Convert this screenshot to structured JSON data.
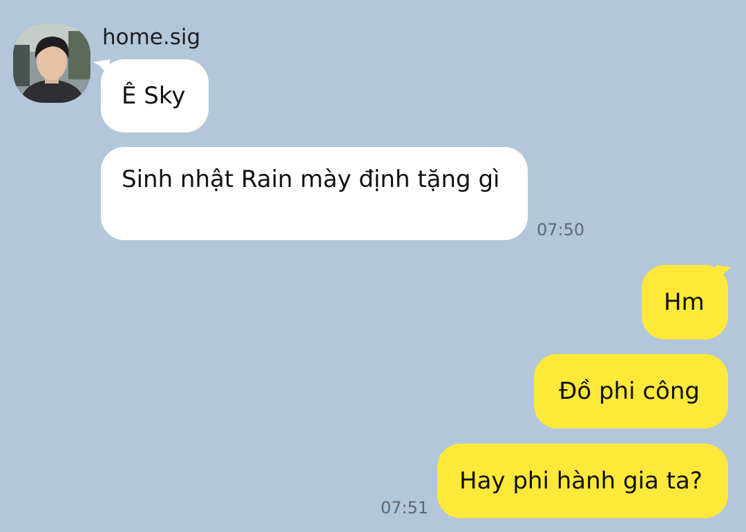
{
  "conversation": {
    "contact": {
      "name": "home.sig",
      "avatar_icon": "profile-photo"
    },
    "incoming": [
      {
        "text": "Ê Sky"
      },
      {
        "text": "Sinh nhật Rain mày định tặng gì"
      }
    ],
    "incoming_time": "07:50",
    "outgoing": [
      {
        "text": "Hm"
      },
      {
        "text": "Đồ phi công"
      },
      {
        "text": "Hay phi hành gia ta?"
      }
    ],
    "outgoing_time": "07:51"
  },
  "colors": {
    "background": "#b2c7da",
    "incoming_bubble": "#ffffff",
    "outgoing_bubble": "#fee93a",
    "timestamp": "#5f6870"
  }
}
